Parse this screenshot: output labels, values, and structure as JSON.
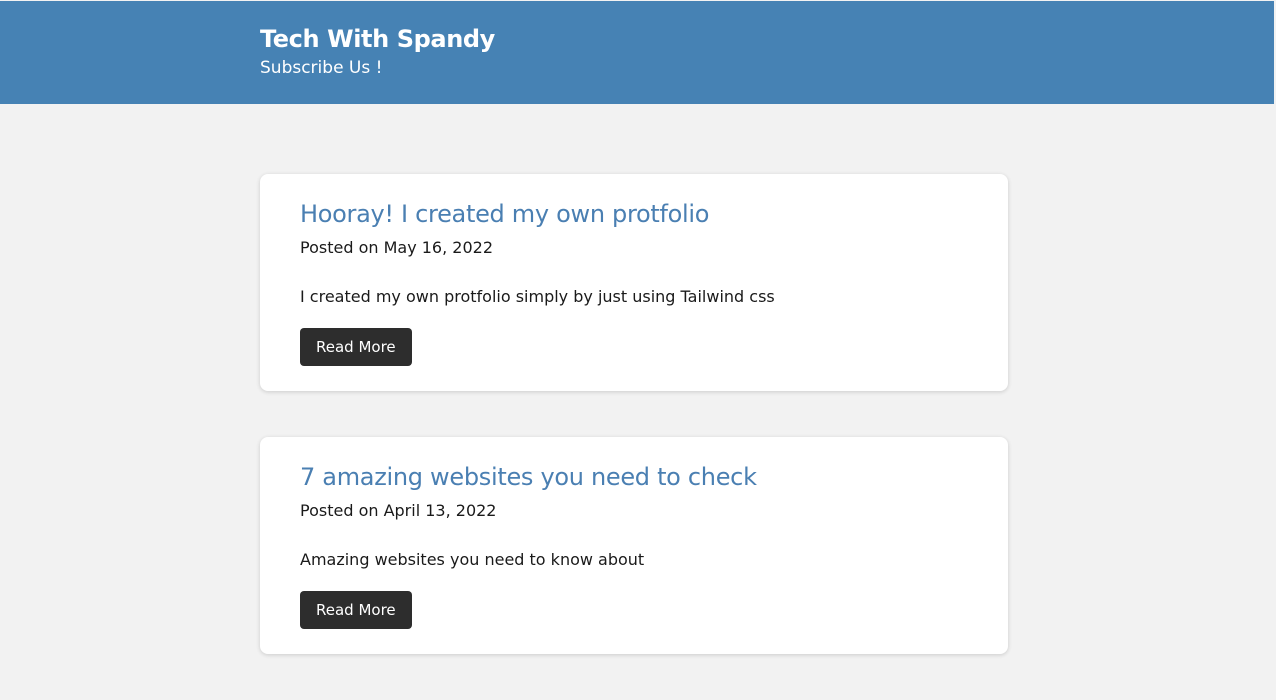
{
  "header": {
    "title": "Tech With Spandy",
    "subscribe_label": "Subscribe Us !"
  },
  "posts": [
    {
      "title": "Hooray! I created my own protfolio",
      "date": "Posted on May 16, 2022",
      "excerpt": "I created my own protfolio simply by just using Tailwind css",
      "button_label": "Read More"
    },
    {
      "title": "7 amazing websites you need to check",
      "date": "Posted on April 13, 2022",
      "excerpt": "Amazing websites you need to know about",
      "button_label": "Read More"
    }
  ],
  "colors": {
    "header_bg": "#4682b4",
    "title_link": "#4a7fb2",
    "button_bg": "#2d2d2d",
    "page_bg": "#f2f2f2"
  }
}
